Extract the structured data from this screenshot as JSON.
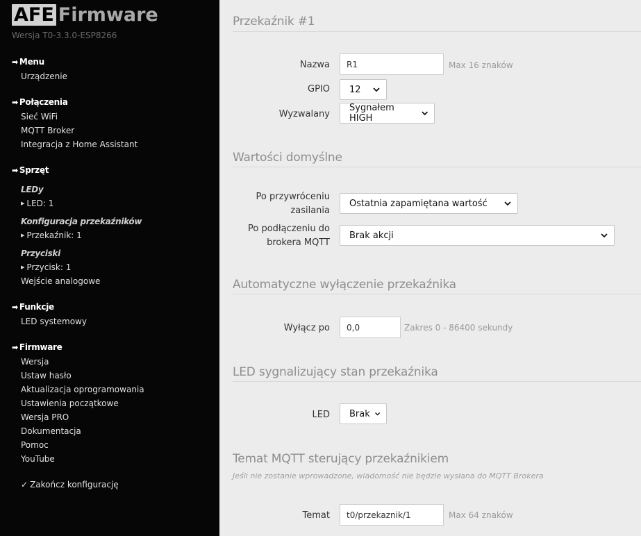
{
  "sidebar": {
    "logo_box": "AFE",
    "logo_text": "Firmware",
    "version": "Wersja T0-3.3.0-ESP8266",
    "menu": {
      "title": "Menu",
      "items": [
        "Urządzenie"
      ]
    },
    "connections": {
      "title": "Połączenia",
      "items": [
        "Sieć WiFi",
        "MQTT Broker",
        "Integracja z Home Assistant"
      ]
    },
    "hardware": {
      "title": "Sprzęt",
      "leds_title": "LEDy",
      "led_item": "LED: 1",
      "relays_title": "Konfiguracja przekaźników",
      "relay_item": "Przekaźnik: 1",
      "buttons_title": "Przyciski",
      "button_item": "Przycisk: 1",
      "analog": "Wejście analogowe"
    },
    "functions": {
      "title": "Funkcje",
      "items": [
        "LED systemowy"
      ]
    },
    "firmware": {
      "title": "Firmware",
      "items": [
        "Wersja",
        "Ustaw hasło",
        "Aktualizacja oprogramowania",
        "Ustawienia początkowe",
        "Wersja PRO",
        "Dokumentacja",
        "Pomoc",
        "YouTube"
      ]
    },
    "finish": "Zakończ konfigurację"
  },
  "relay": {
    "title": "Przekaźnik #1",
    "name_label": "Nazwa",
    "name_value": "R1",
    "name_hint": "Max 16 znaków",
    "gpio_label": "GPIO",
    "gpio_value": "12",
    "trigger_label": "Wyzwalany",
    "trigger_value": "Sygnałem HIGH"
  },
  "defaults": {
    "title": "Wartości domyślne",
    "power_label_1": "Po przywróceniu",
    "power_label_2": "zasilania",
    "power_value": "Ostatnia zapamiętana wartość",
    "mqtt_label_1": "Po podłączeniu do",
    "mqtt_label_2": "brokera MQTT",
    "mqtt_value": "Brak akcji"
  },
  "auto_off": {
    "title": "Automatyczne wyłączenie przekaźnika",
    "label": "Wyłącz po",
    "value": "0,0",
    "hint": "Zakres 0 - 86400 sekundy"
  },
  "led_state": {
    "title": "LED sygnalizujący stan przekaźnika",
    "label": "LED",
    "value": "Brak"
  },
  "mqtt_topic": {
    "title": "Temat MQTT sterujący przekaźnikiem",
    "note": "Jeśli nie zostanie wprowadzone, wiadomość nie będzie wysłana do MQTT Brokera",
    "label": "Temat",
    "value": "t0/przekaznik/1",
    "hint": "Max 64 znaków"
  }
}
